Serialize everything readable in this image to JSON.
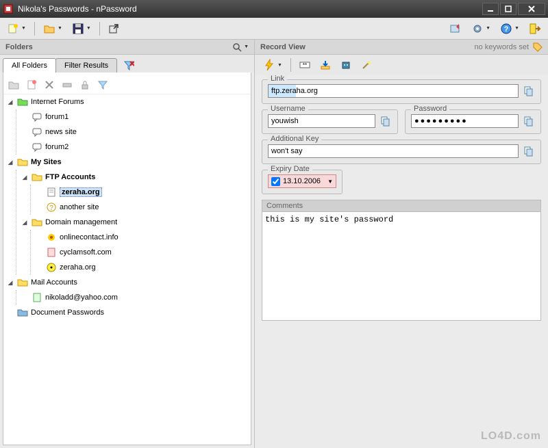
{
  "window": {
    "title": "Nikola's Passwords - nPassword"
  },
  "folders_panel": {
    "title": "Folders",
    "tabs": {
      "all": "All Folders",
      "filter": "Filter Results"
    }
  },
  "tree": {
    "internet_forums": {
      "label": "Internet Forums",
      "children": {
        "forum1": "forum1",
        "news_site": "news site",
        "forum2": "forum2"
      }
    },
    "my_sites": {
      "label": "My Sites",
      "ftp_accounts": {
        "label": "FTP Accounts",
        "zeraha": "zeraha.org",
        "another": "another site"
      },
      "domain_mgmt": {
        "label": "Domain management",
        "onlinecontact": "onlinecontact.info",
        "cyclamsoft": "cyclamsoft.com",
        "zeraha2": "zeraha.org"
      }
    },
    "mail_accounts": {
      "label": "Mail Accounts",
      "nikoladd": "nikoladd@yahoo.com"
    },
    "doc_passwords": {
      "label": "Document Passwords"
    }
  },
  "record_view": {
    "title": "Record View",
    "no_keywords": "no keywords set",
    "link": {
      "label": "Link",
      "value": "ftp.zeraha.org"
    },
    "username": {
      "label": "Username",
      "value": "youwish"
    },
    "password": {
      "label": "Password",
      "value": "●●●●●●●●●"
    },
    "additional_key": {
      "label": "Additional Key",
      "value": "won't say"
    },
    "expiry": {
      "label": "Expiry Date",
      "value": "13.10.2006"
    },
    "comments": {
      "label": "Comments",
      "value": "this is my site's password"
    }
  },
  "watermark": "LO4D.com"
}
